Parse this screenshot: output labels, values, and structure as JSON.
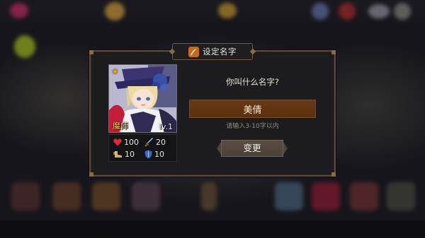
{
  "dialog": {
    "title": "设定名字",
    "title_icon": "quill-icon",
    "question": "你叫什么名字?",
    "name_value": "美倩",
    "hint": "请输入3-10字以内",
    "change_button": "变更"
  },
  "hero": {
    "star_glyph": "★",
    "class_name": "魔师",
    "level": "lv.1",
    "stats": {
      "hp": "100",
      "attack": "20",
      "speed": "10",
      "defense": "10"
    }
  },
  "colors": {
    "accent_orange": "#c56a1c",
    "name_field": "#5a3010",
    "gold_text": "#ffd64a"
  }
}
